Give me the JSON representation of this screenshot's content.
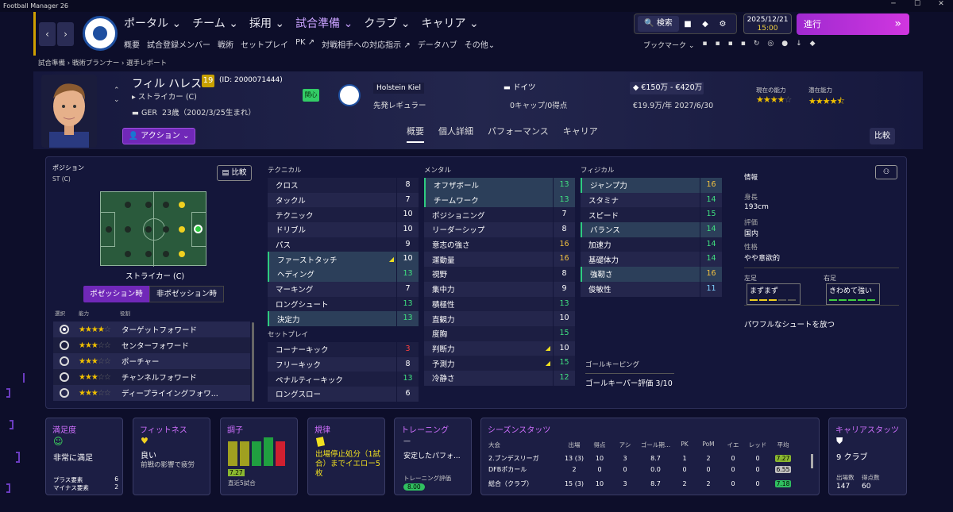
{
  "window": {
    "title": "Football Manager 26"
  },
  "nav": {
    "main": [
      "ポータル",
      "チーム",
      "採用",
      "試合準備",
      "クラブ",
      "キャリア"
    ],
    "active": "試合準備",
    "sub": [
      "概要",
      "試合登録メンバー",
      "戦術",
      "セットプレイ",
      "PK",
      "対戦相手への対応指示",
      "データハブ",
      "その他"
    ],
    "search": "検索",
    "date": "2025/12/21",
    "time": "15:00",
    "continue": "進行",
    "bookmarks": "ブックマーク"
  },
  "breadcrumb": [
    "試合準備",
    "戦術プランナー",
    "選手レポート"
  ],
  "player": {
    "name": "フィル ハレス",
    "number": "19",
    "id": "(ID: 2000071444)",
    "position": "ストライカー (C)",
    "nation_code": "GER",
    "age": "23歳（2002/3/25生まれ）",
    "interest": "関心",
    "club": "Holstein Kiel",
    "club_role": "先発レギュラー",
    "nationality": "ドイツ",
    "caps": "0キャップ/0得点",
    "value": "€150万 - €420万",
    "wage": "€19.9万/年 2027/6/30",
    "current_ability_label": "現在の能力",
    "potential_ability_label": "潜在能力",
    "current_stars": 4,
    "potential_stars": 4.5
  },
  "actions": {
    "action_btn": "アクション",
    "compare": "比較"
  },
  "tabs": [
    "概要",
    "個人詳細",
    "パフォーマンス",
    "キャリア"
  ],
  "position_panel": {
    "label": "ポジション",
    "value": "ST (C)",
    "compare": "比較",
    "pos_name": "ストライカー (C)",
    "in_possession": "ポゼッション時",
    "out_possession": "非ポゼッション時",
    "headers": [
      "選択",
      "能力",
      "役割"
    ],
    "roles": [
      {
        "name": "ターゲットフォワード",
        "stars": 4,
        "selected": true
      },
      {
        "name": "センターフォワード",
        "stars": 3,
        "selected": false
      },
      {
        "name": "ポーチャー",
        "stars": 3,
        "selected": false
      },
      {
        "name": "チャンネルフォワード",
        "stars": 3,
        "selected": false
      },
      {
        "name": "ディープライイングフォワ...",
        "stars": 3,
        "selected": false
      }
    ]
  },
  "attributes": {
    "technical_title": "テクニカル",
    "technical": [
      {
        "name": "クロス",
        "value": "8"
      },
      {
        "name": "タックル",
        "value": "7"
      },
      {
        "name": "テクニック",
        "value": "10"
      },
      {
        "name": "ドリブル",
        "value": "10"
      },
      {
        "name": "パス",
        "value": "9"
      },
      {
        "name": "ファーストタッチ",
        "value": "10",
        "hl": true,
        "flag": true
      },
      {
        "name": "ヘディング",
        "value": "13",
        "hl": true,
        "col": "g"
      },
      {
        "name": "マーキング",
        "value": "7"
      },
      {
        "name": "ロングシュート",
        "value": "13",
        "col": "g"
      },
      {
        "name": "決定力",
        "value": "13",
        "hl": true,
        "col": "g"
      }
    ],
    "setpiece_title": "セットプレイ",
    "setpiece": [
      {
        "name": "コーナーキック",
        "value": "3",
        "col": "r"
      },
      {
        "name": "フリーキック",
        "value": "8"
      },
      {
        "name": "ペナルティーキック",
        "value": "13",
        "col": "g"
      },
      {
        "name": "ロングスロー",
        "value": "6"
      }
    ],
    "mental_title": "メンタル",
    "mental": [
      {
        "name": "オフザボール",
        "value": "13",
        "hl": true,
        "col": "g"
      },
      {
        "name": "チームワーク",
        "value": "13",
        "hl": true,
        "col": "g"
      },
      {
        "name": "ポジショニング",
        "value": "7"
      },
      {
        "name": "リーダーシップ",
        "value": "8"
      },
      {
        "name": "意志の強さ",
        "value": "16",
        "col": "y"
      },
      {
        "name": "運動量",
        "value": "16",
        "col": "y"
      },
      {
        "name": "視野",
        "value": "8"
      },
      {
        "name": "集中力",
        "value": "9"
      },
      {
        "name": "積極性",
        "value": "13",
        "col": "g"
      },
      {
        "name": "直観力",
        "value": "10"
      },
      {
        "name": "度胸",
        "value": "15",
        "col": "g"
      },
      {
        "name": "判断力",
        "value": "10",
        "flag": true
      },
      {
        "name": "予測力",
        "value": "15",
        "col": "g",
        "flag": true
      },
      {
        "name": "冷静さ",
        "value": "12",
        "col": "g"
      }
    ],
    "physical_title": "フィジカル",
    "physical": [
      {
        "name": "ジャンプ力",
        "value": "16",
        "hl": true,
        "col": "y"
      },
      {
        "name": "スタミナ",
        "value": "14",
        "col": "g"
      },
      {
        "name": "スピード",
        "value": "15",
        "col": "g"
      },
      {
        "name": "バランス",
        "value": "14",
        "hl": true,
        "col": "g"
      },
      {
        "name": "加速力",
        "value": "14",
        "col": "g"
      },
      {
        "name": "基礎体力",
        "value": "14",
        "col": "g"
      },
      {
        "name": "強靭さ",
        "value": "16",
        "hl": true,
        "col": "y"
      },
      {
        "name": "俊敏性",
        "value": "11",
        "col": "b"
      }
    ],
    "gk_title": "ゴールキーピング",
    "gk_value": "ゴールキーパー評価 3/10"
  },
  "info": {
    "title": "情報",
    "height_label": "身長",
    "height": "193cm",
    "rating_label": "評価",
    "rating": "国内",
    "personality_label": "性格",
    "personality": "やや意欲的",
    "left_foot_label": "左足",
    "left_foot": "まずまず",
    "right_foot_label": "右足",
    "right_foot": "きわめて強い",
    "trait": "パワフルなシュートを放つ"
  },
  "cards": {
    "satisfaction": {
      "title": "満足度",
      "value": "非常に満足",
      "plus_label": "プラス要素",
      "plus": "6",
      "minus_label": "マイナス要素",
      "minus": "2"
    },
    "fitness": {
      "title": "フィットネス",
      "value": "良い",
      "note": "前戦の影響で疲労"
    },
    "form": {
      "title": "調子",
      "avg": "7.27",
      "label": "直近5試合"
    },
    "discipline": {
      "title": "規律",
      "text": "出場停止処分（1試合）までイエロー5枚"
    },
    "training": {
      "title": "トレーニング",
      "dash": "—",
      "text": "安定したパフォ...",
      "label": "トレーニング評価",
      "value": "8.00"
    },
    "season": {
      "title": "シーズンスタッツ",
      "headers": [
        "大会",
        "出場",
        "得点",
        "アシ",
        "ゴール期...",
        "PK",
        "PoM",
        "イエ",
        "レッド",
        "平均"
      ],
      "rows": [
        [
          "2.ブンデスリーガ",
          "13 (3)",
          "10",
          "3",
          "8.7",
          "1",
          "2",
          "0",
          "0",
          "7.27"
        ],
        [
          "DFBポカール",
          "2",
          "0",
          "0",
          "0.0",
          "0",
          "0",
          "0",
          "0",
          "6.55"
        ],
        [
          "総合（クラブ）",
          "15 (3)",
          "10",
          "3",
          "8.7",
          "2",
          "2",
          "0",
          "0",
          "7.18"
        ]
      ]
    },
    "career": {
      "title": "キャリアスタッツ",
      "clubs": "9 クラブ",
      "apps_label": "出場数",
      "apps": "147",
      "goals_label": "得点数",
      "goals": "60"
    }
  }
}
